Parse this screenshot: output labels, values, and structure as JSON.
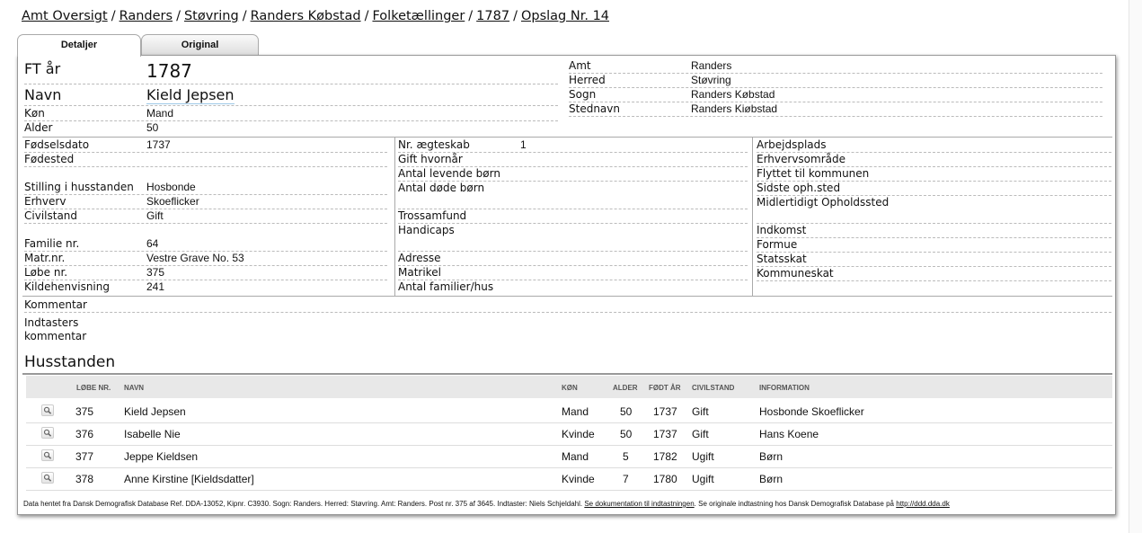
{
  "breadcrumb": {
    "items": [
      "Amt Oversigt",
      "Randers",
      "Støvring",
      "Randers Købstad",
      "Folketællinger",
      "1787",
      "Opslag Nr. 14"
    ],
    "separator": "/"
  },
  "tabs": {
    "details": "Detaljer",
    "original": "Original"
  },
  "person": {
    "ft_year_label": "FT år",
    "ft_year": "1787",
    "name_label": "Navn",
    "name": "Kield Jepsen",
    "gender_label": "Køn",
    "gender": "Mand",
    "age_label": "Alder",
    "age": "50"
  },
  "location": {
    "amt_label": "Amt",
    "amt": "Randers",
    "herred_label": "Herred",
    "herred": "Støvring",
    "sogn_label": "Sogn",
    "sogn": "Randers Købstad",
    "stednavn_label": "Stednavn",
    "stednavn": "Randers Kiøbstad"
  },
  "col1": {
    "birthdate_label": "Fødselsdato",
    "birthdate": "1737",
    "birthplace_label": "Fødested",
    "position_label": "Stilling i husstanden",
    "position": "Hosbonde",
    "occupation_label": "Erhverv",
    "occupation": "Skoeflicker",
    "civil_label": "Civilstand",
    "civil": "Gift",
    "family_label": "Familie nr.",
    "family": "64",
    "matr_label": "Matr.nr.",
    "matr": "Vestre Grave No. 53",
    "lobe_label": "Løbe nr.",
    "lobe": "375",
    "source_label": "Kildehenvisning",
    "source": "241"
  },
  "col2": {
    "marriage_label": "Nr. ægteskab",
    "marriage": "1",
    "married_when_label": "Gift hvornår",
    "living_children_label": "Antal levende børn",
    "dead_children_label": "Antal døde børn",
    "religion_label": "Trossamfund",
    "handicaps_label": "Handicaps",
    "address_label": "Adresse",
    "matrikel_label": "Matrikel",
    "families_label": "Antal familier/hus"
  },
  "col3": {
    "workplace_label": "Arbejdsplads",
    "work_area_label": "Erhvervsområde",
    "moved_label": "Flyttet til kommunen",
    "last_stay_label": "Sidste oph.sted",
    "temp_stay_label": "Midlertidigt Opholdssted",
    "income_label": "Indkomst",
    "wealth_label": "Formue",
    "state_tax_label": "Statsskat",
    "municipal_tax_label": "Kommuneskat"
  },
  "comments": {
    "comment_label": "Kommentar",
    "typist_comment_label_1": "Indtasters",
    "typist_comment_label_2": "kommentar"
  },
  "household": {
    "title": "Husstanden",
    "headers": {
      "lobe": "LØBE NR.",
      "name": "NAVN",
      "gender": "KØN",
      "age": "ALDER",
      "born": "FØDT ÅR",
      "civil": "CIVILSTAND",
      "info": "INFORMATION"
    },
    "rows": [
      {
        "lobe": "375",
        "name": "Kield Jepsen",
        "gender": "Mand",
        "age": "50",
        "born": "1737",
        "civil": "Gift",
        "info": "Hosbonde Skoeflicker"
      },
      {
        "lobe": "376",
        "name": "Isabelle Nie",
        "gender": "Kvinde",
        "age": "50",
        "born": "1737",
        "civil": "Gift",
        "info": "Hans Koene"
      },
      {
        "lobe": "377",
        "name": "Jeppe Kieldsen",
        "gender": "Mand",
        "age": "5",
        "born": "1782",
        "civil": "Ugift",
        "info": "Børn"
      },
      {
        "lobe": "378",
        "name": "Anne Kirstine [Kieldsdatter]",
        "gender": "Kvinde",
        "age": "7",
        "born": "1780",
        "civil": "Ugift",
        "info": "Børn"
      }
    ]
  },
  "footer": {
    "text_1": "Data hentet fra Dansk Demografisk Database Ref. DDA-13052, Kipnr. C3930. Sogn: Randers. Herred: Støvring. Amt: Randers. Post nr. 375 af 3645. Indtaster: Niels Schjeldahl.",
    "doc_link": "Se dokumentation til indtastningen",
    "text_2": ". Se originale indtastning hos Dansk Demografisk Database på",
    "dda_link": "http://ddd.dda.dk"
  },
  "icons": {
    "row_view": "magnifier-icon"
  }
}
